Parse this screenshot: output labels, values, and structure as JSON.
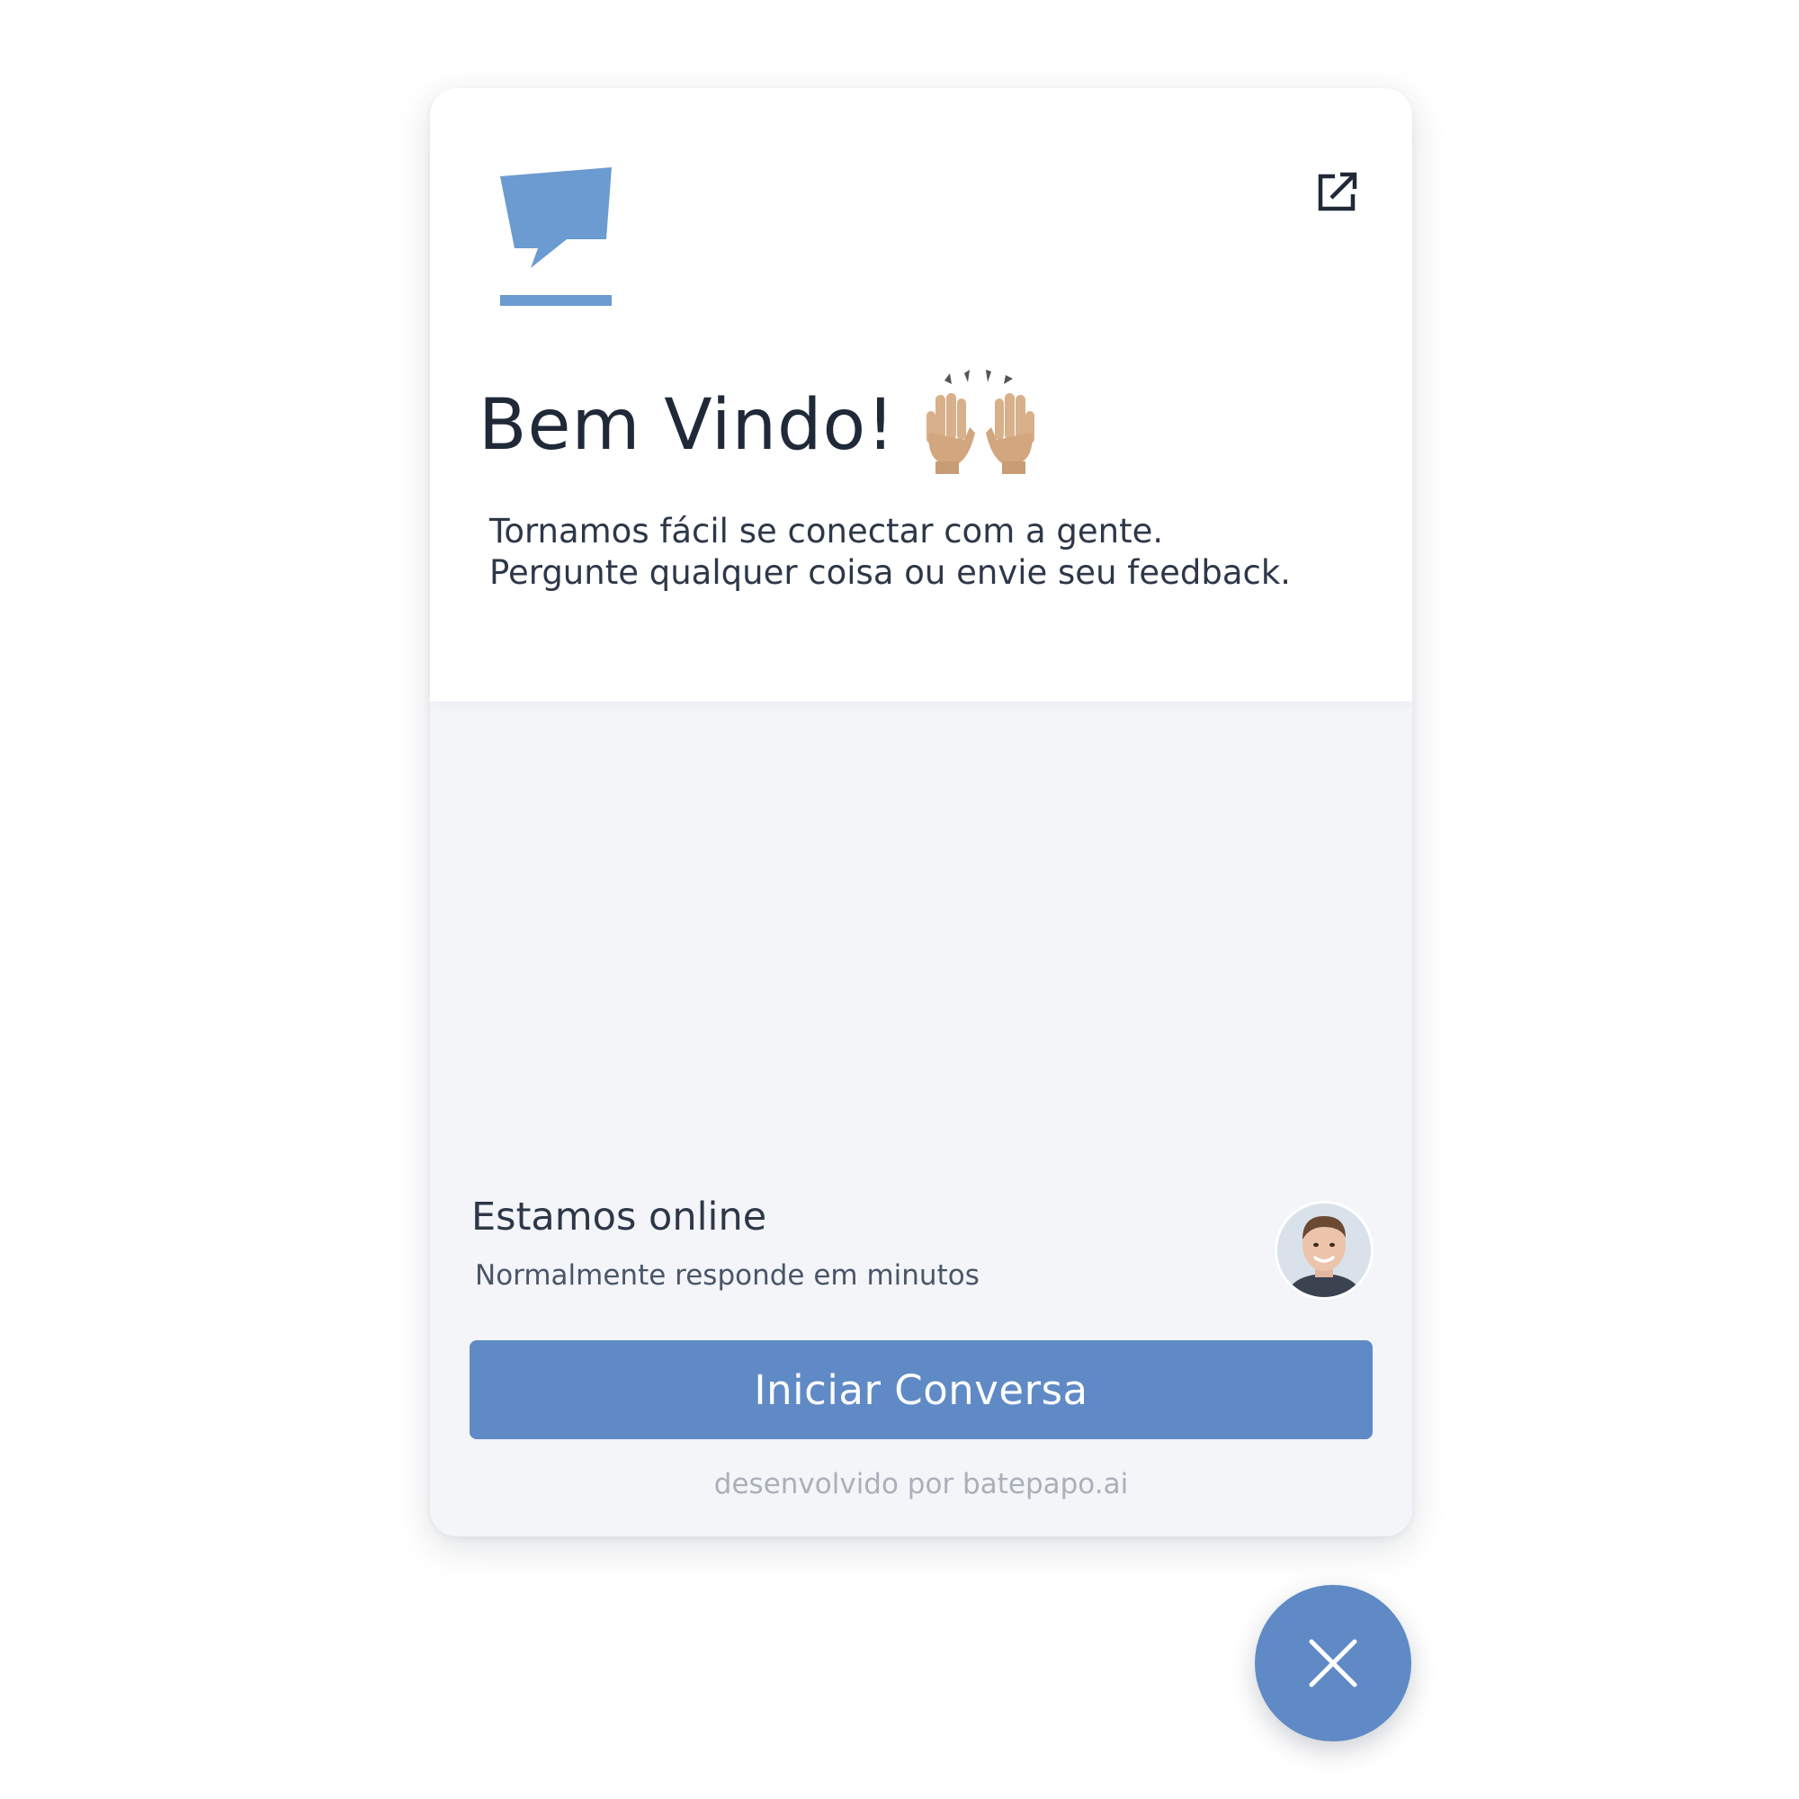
{
  "header": {
    "title": "Bem Vindo!",
    "intro_lines": [
      "Tornamos fácil se conectar com a gente.",
      "Pergunte qualquer coisa ou envie seu feedback."
    ],
    "popout_icon": "external-link-icon",
    "logo_icon": "chat-bubble-logo"
  },
  "status": {
    "title": "Estamos online",
    "subtitle": "Normalmente responde em minutos"
  },
  "actions": {
    "start_label": "Iniciar Conversa"
  },
  "footer": {
    "powered_by": "desenvolvido por batepapo.ai"
  },
  "colors": {
    "accent": "#5f8ac5",
    "logo": "#6b9bd1",
    "panel_bg": "#f3f5f9",
    "text_dark": "#1f2937"
  }
}
